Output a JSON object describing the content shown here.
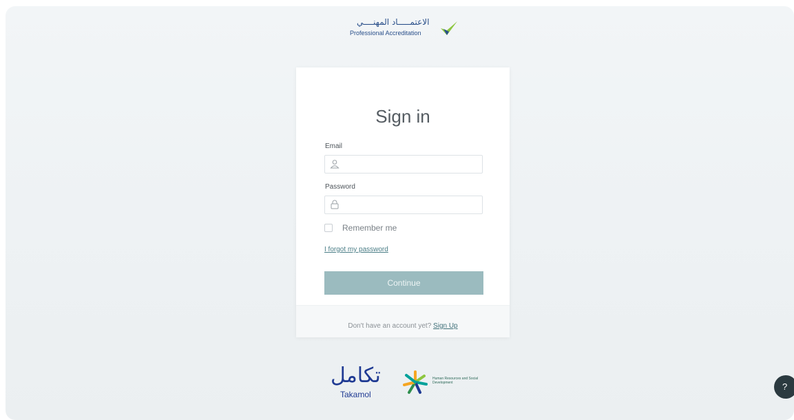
{
  "brand": {
    "arabic": "الاعتمـــــاد المهنــــي",
    "english": "Professional Accreditation"
  },
  "signin": {
    "title": "Sign in",
    "email_label": "Email",
    "email_value": "",
    "password_label": "Password",
    "password_value": "",
    "remember_label": "Remember me",
    "remember_checked": false,
    "forgot_link": "I forgot my password",
    "continue_button": "Continue",
    "no_account_text": "Don't have an account yet?",
    "signup_link": "Sign Up"
  },
  "footer_logos": {
    "takamol_arabic": "تكامل",
    "takamol_english": "Takamol",
    "ministry_text": "Human Resources and Social Development"
  },
  "help": {
    "icon": "question-icon",
    "label": "?"
  },
  "colors": {
    "accent": "#9bbbbf",
    "link": "#3e6f78",
    "brand_blue": "#1f3a93",
    "check_green": "#8dc63f"
  }
}
